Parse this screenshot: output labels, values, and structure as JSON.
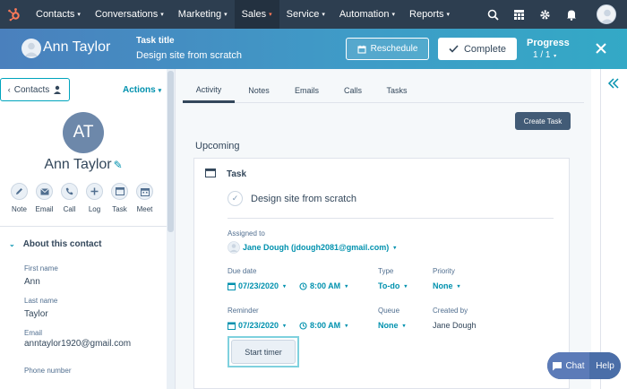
{
  "nav": {
    "items": [
      {
        "label": "Contacts",
        "active": false
      },
      {
        "label": "Conversations",
        "active": false
      },
      {
        "label": "Marketing",
        "active": false
      },
      {
        "label": "Sales",
        "active": true
      },
      {
        "label": "Service",
        "active": false
      },
      {
        "label": "Automation",
        "active": false
      },
      {
        "label": "Reports",
        "active": false
      }
    ],
    "icons": [
      "search-icon",
      "marketplace-icon",
      "settings-icon",
      "notifications-icon"
    ],
    "brand_color": "#ff7a59",
    "bg_color": "#2d3e50"
  },
  "header": {
    "contact_name": "Ann Taylor",
    "task_label": "Task title",
    "task_title": "Design site from scratch",
    "reschedule_label": "Reschedule",
    "complete_label": "Complete",
    "progress_label": "Progress",
    "progress_value": "1 / 1"
  },
  "sidebar": {
    "contacts_label": "Contacts",
    "actions_label": "Actions",
    "initials": "AT",
    "name": "Ann Taylor",
    "actions": [
      "Note",
      "Email",
      "Call",
      "Log",
      "Task",
      "Meet"
    ],
    "about_label": "About this contact",
    "fields": [
      {
        "label": "First name",
        "value": "Ann"
      },
      {
        "label": "Last name",
        "value": "Taylor"
      },
      {
        "label": "Email",
        "value": "anntaylor1920@gmail.com"
      },
      {
        "label": "Phone number",
        "value": ""
      }
    ]
  },
  "main": {
    "tabs": [
      {
        "label": "Activity",
        "active": true
      },
      {
        "label": "Notes",
        "active": false
      },
      {
        "label": "Emails",
        "active": false
      },
      {
        "label": "Calls",
        "active": false
      },
      {
        "label": "Tasks",
        "active": false
      }
    ],
    "create_task_label": "Create Task",
    "upcoming_label": "Upcoming",
    "card": {
      "type_label": "Task",
      "title": "Design site from scratch",
      "assigned_label": "Assigned to",
      "assigned_value": "Jane Dough (jdough2081@gmail.com)",
      "due_label": "Due date",
      "due_date": "07/23/2020",
      "due_time": "8:00 AM",
      "type_field_label": "Type",
      "type_value": "To-do",
      "priority_label": "Priority",
      "priority_value": "None",
      "reminder_label": "Reminder",
      "reminder_date": "07/23/2020",
      "reminder_time": "8:00 AM",
      "queue_label": "Queue",
      "queue_value": "None",
      "created_by_label": "Created by",
      "created_by_value": "Jane Dough",
      "start_timer_label": "Start timer"
    }
  },
  "chat": {
    "chat_label": "Chat",
    "help_label": "Help"
  }
}
